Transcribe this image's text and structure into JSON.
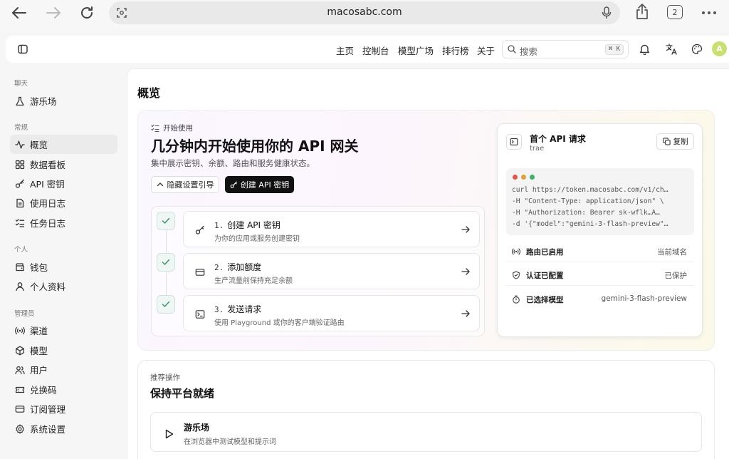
{
  "browser": {
    "url": "macosabc.com",
    "tab_count": "2"
  },
  "header": {
    "nav": [
      "主页",
      "控制台",
      "模型广场",
      "排行榜",
      "关于"
    ],
    "search_placeholder": "搜索",
    "search_shortcut": "⌘ K",
    "avatar_initial": "A"
  },
  "sidebar": {
    "sections": [
      {
        "label": "聊天",
        "items": [
          {
            "label": "游乐场",
            "icon": "flask-icon"
          }
        ]
      },
      {
        "label": "常规",
        "items": [
          {
            "label": "概览",
            "icon": "activity-icon",
            "active": true
          },
          {
            "label": "数据看板",
            "icon": "dashboard-icon"
          },
          {
            "label": "API 密钥",
            "icon": "key-icon"
          },
          {
            "label": "使用日志",
            "icon": "document-icon"
          },
          {
            "label": "任务日志",
            "icon": "list-check-icon"
          }
        ]
      },
      {
        "label": "个人",
        "items": [
          {
            "label": "钱包",
            "icon": "wallet-icon"
          },
          {
            "label": "个人资料",
            "icon": "user-icon"
          }
        ]
      },
      {
        "label": "管理员",
        "items": [
          {
            "label": "渠道",
            "icon": "radio-icon"
          },
          {
            "label": "模型",
            "icon": "box-icon"
          },
          {
            "label": "用户",
            "icon": "users-icon"
          },
          {
            "label": "兑换码",
            "icon": "ticket-icon"
          },
          {
            "label": "订阅管理",
            "icon": "credit-card-icon"
          },
          {
            "label": "系统设置",
            "icon": "settings-icon"
          }
        ]
      }
    ]
  },
  "main": {
    "title": "概览",
    "hero": {
      "tag": "开始使用",
      "title": "几分钟内开始使用你的 API 网关",
      "subtitle": "集中展示密钥、余额、路由和服务健康状态。",
      "hide_button": "隐藏设置引导",
      "create_button": "创建 API 密钥",
      "steps": [
        {
          "num": "1.",
          "title": "创建 API 密钥",
          "desc": "为你的应用或服务创建密钥"
        },
        {
          "num": "2.",
          "title": "添加额度",
          "desc": "生产流量前保持充足余额"
        },
        {
          "num": "3.",
          "title": "发送请求",
          "desc": "使用 Playground 或你的客户端验证路由"
        }
      ]
    },
    "request_card": {
      "title": "首个 API 请求",
      "subtitle": "trae",
      "copy_label": "复制",
      "code": [
        "curl https://token.macosabc.com/v1/ch…",
        "-H \"Content-Type: application/json\" \\",
        "-H \"Authorization: Bearer sk-wflk…A…",
        "-d '{\"model\":\"gemini-3-flash-preview\"…"
      ],
      "info": [
        {
          "label": "路由已启用",
          "value": "当前域名"
        },
        {
          "label": "认证已配置",
          "value": "已保护"
        },
        {
          "label": "已选择模型",
          "value": "gemini-3-flash-preview"
        }
      ]
    },
    "recommended": {
      "label": "推荐操作",
      "title": "保持平台就绪",
      "card": {
        "title": "游乐场",
        "desc": "在浏览器中测试模型和提示词"
      }
    }
  }
}
